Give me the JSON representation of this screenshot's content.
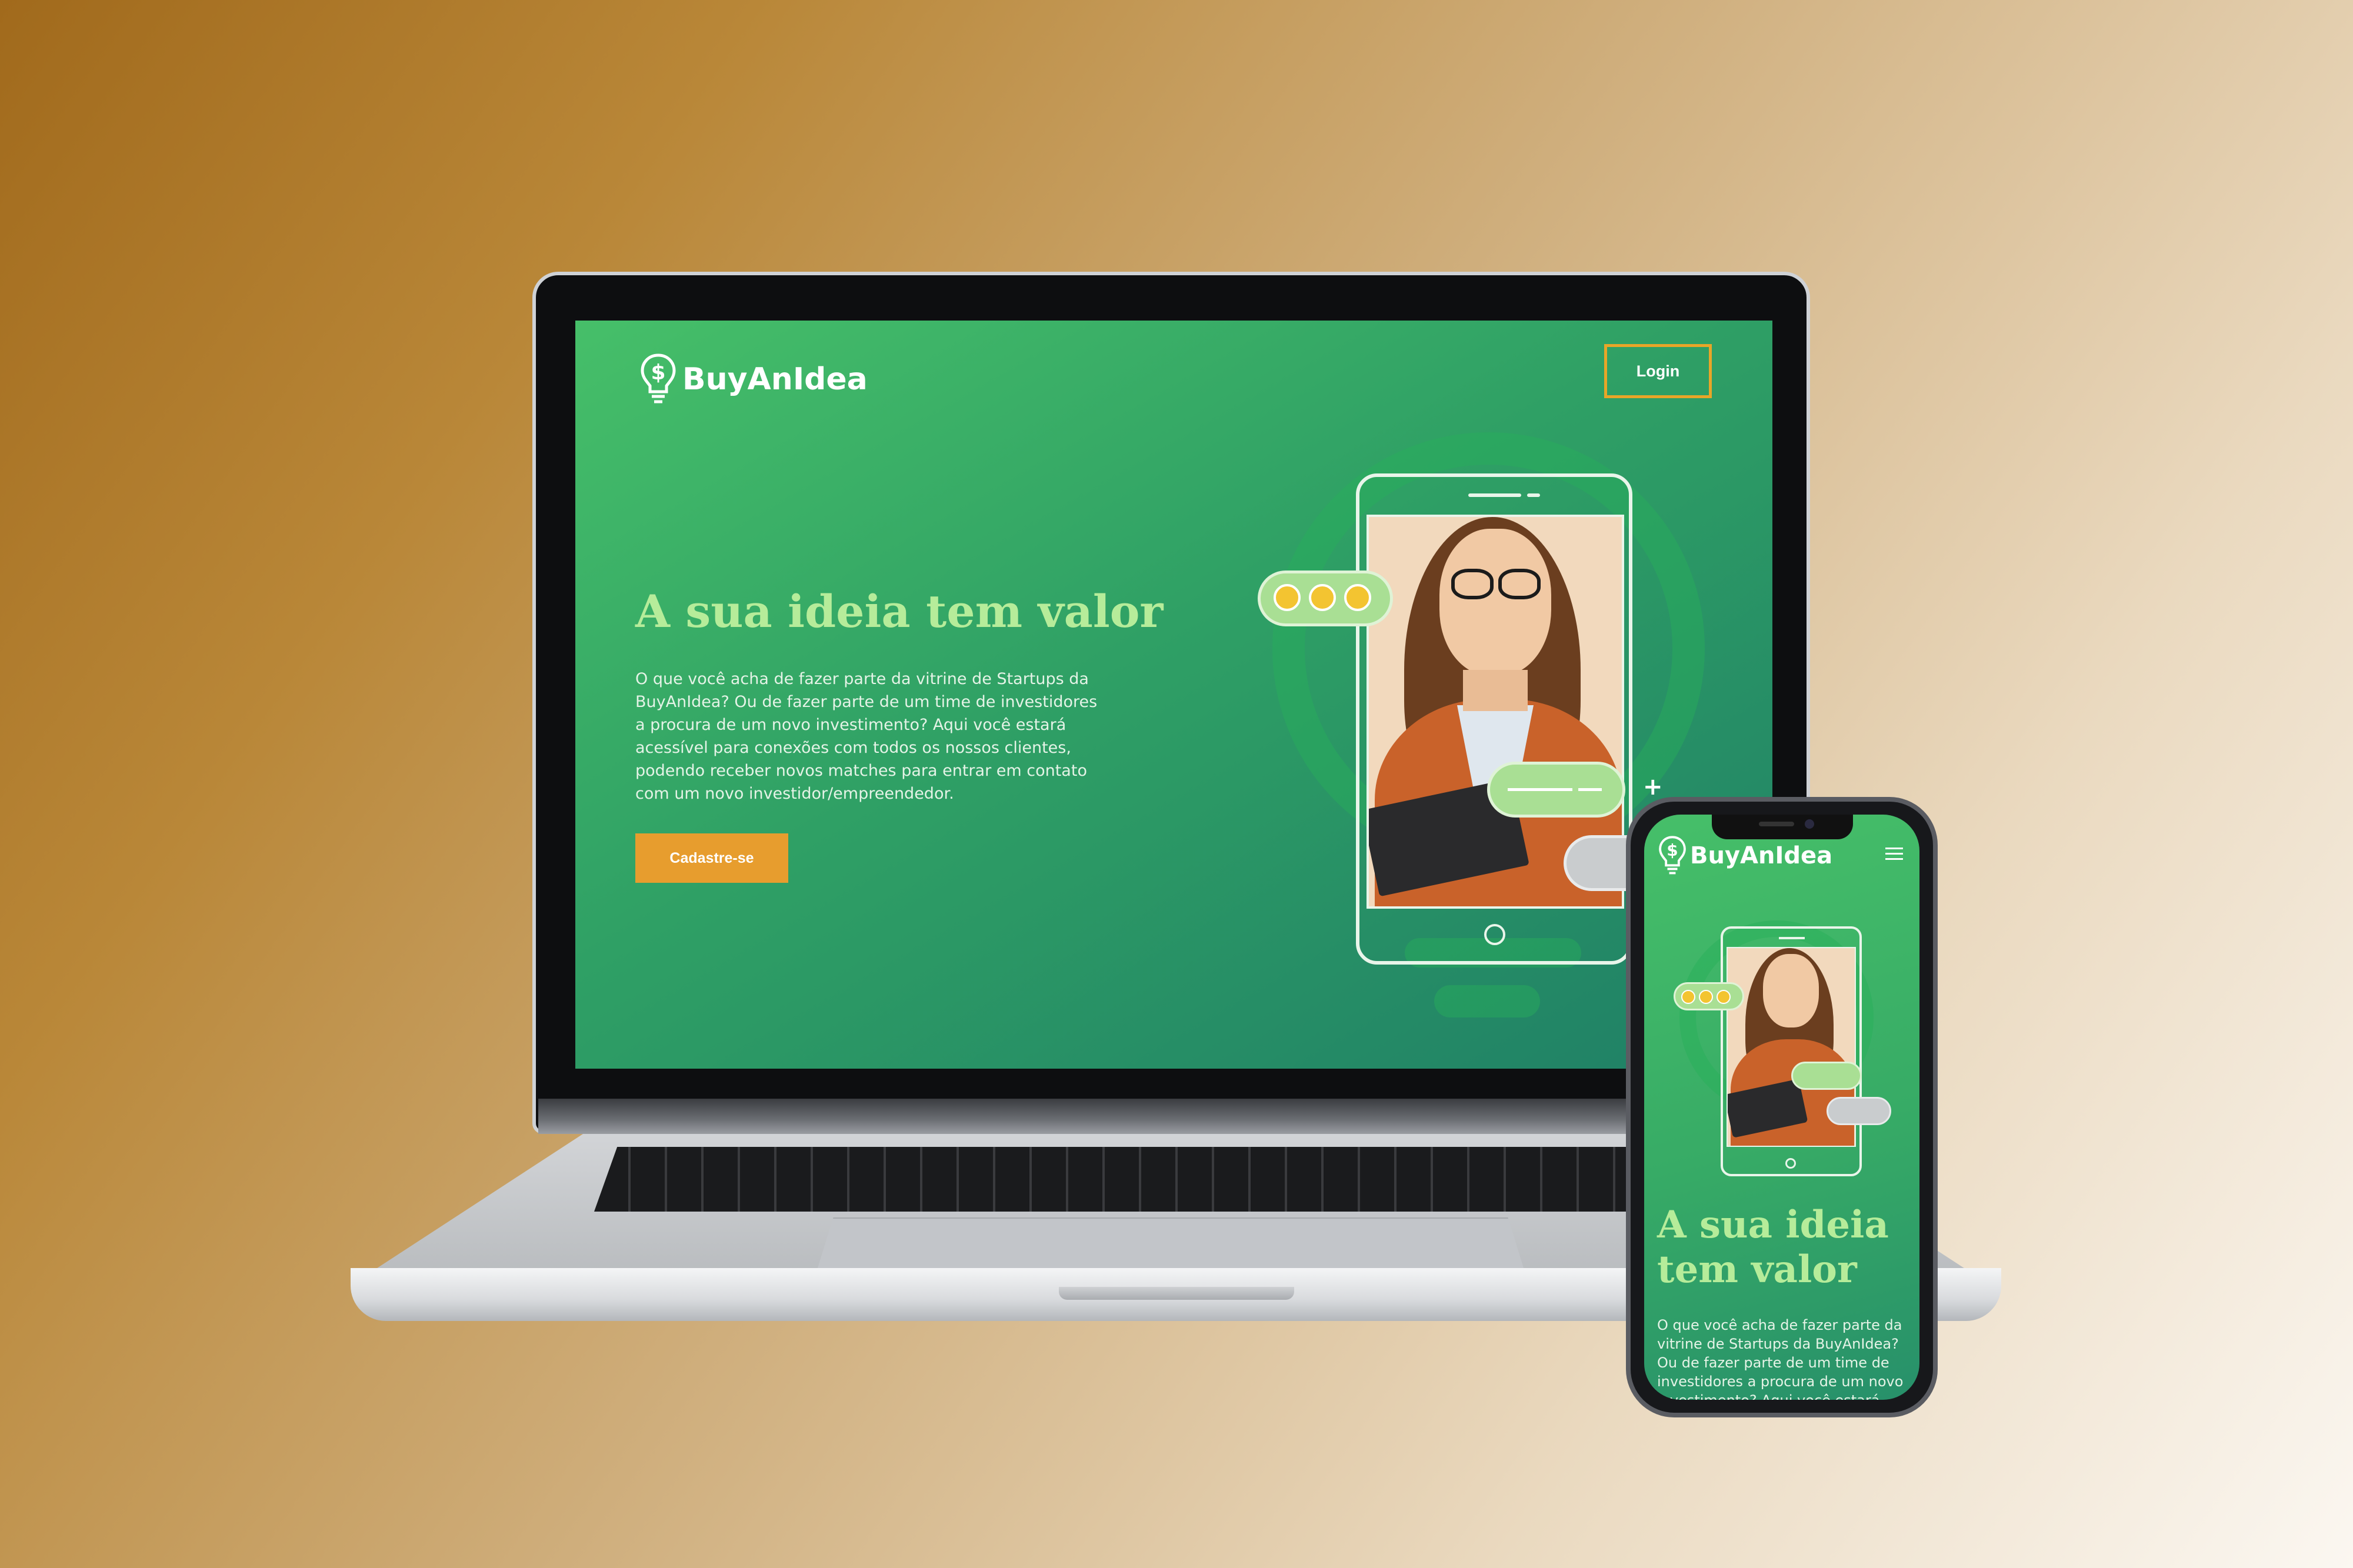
{
  "brand": {
    "name_bold": "BuyAn",
    "name_light": "An",
    "name": "BuyAnIdea"
  },
  "desktop": {
    "login_label": "Login",
    "title": "A sua ideia tem valor",
    "description": "O que você acha de fazer parte da vitrine de Startups da BuyAnIdea? Ou de fazer parte de um time de investidores a procura de um novo investimento? Aqui você estará acessível para conexões com todos os nossos clientes, podendo receber novos matches para entrar em contato com um novo investidor/empreendedor.",
    "signup_label": "Cadastre-se"
  },
  "mobile": {
    "title": "A sua ideia tem valor",
    "description": "O que você acha de fazer parte da vitrine de Startups da BuyAnIdea? Ou de fazer parte de um time de investidores a procura de um novo investimento? Aqui você estará acessível"
  },
  "hero": {
    "rating_stars": 3,
    "plus_symbol": "+"
  },
  "colors": {
    "accent": "#e79d2e",
    "title_green": "#b6ec9a",
    "bg_green": "#3aae66"
  },
  "icons": {
    "logo": "dollar-bulb-icon",
    "menu": "hamburger-icon",
    "star": "star-icon"
  }
}
